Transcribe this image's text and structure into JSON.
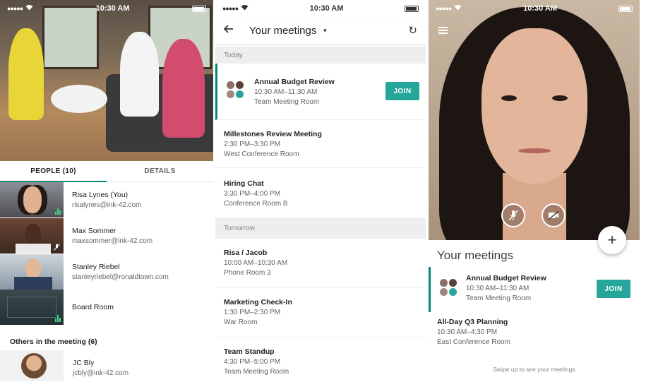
{
  "status_bar": {
    "time": "10:30 AM",
    "signal": "●●●●●"
  },
  "colors": {
    "accent": "#00897b",
    "join": "#26a69a",
    "talk_indicator": "#3ddc84"
  },
  "phone1": {
    "tabs": [
      {
        "label": "PEOPLE (10)"
      },
      {
        "label": "DETAILS"
      }
    ],
    "participants": [
      {
        "name": "Risa Lynes (You)",
        "email": "risalynes@ink-42.com"
      },
      {
        "name": "Max Sommer",
        "email": "maxsommer@ink-42.com"
      },
      {
        "name": "Stanley Riebel",
        "email": "stanleyriebel@ronaldtown.com"
      },
      {
        "name": "Board Room",
        "email": ""
      }
    ],
    "others_heading": "Others in the meeting  (6)",
    "others": [
      {
        "name": "JC Bly",
        "email": "jcbly@ink-42.com"
      }
    ]
  },
  "phone2": {
    "title": "Your meetings",
    "sections": [
      {
        "label": "Today",
        "meetings": [
          {
            "title": "Annual Budget Review",
            "time": "10:30 AM–11:30 AM",
            "room": "Team Meeting Room",
            "join": "JOIN"
          },
          {
            "title": "Millestones Review Meeting",
            "time": "2:30 PM–3:30 PM",
            "room": "West Conference Room"
          },
          {
            "title": "Hiring Chat",
            "time": "3:30 PM–4:00 PM",
            "room": "Conference Room B"
          }
        ]
      },
      {
        "label": "Tomorrow",
        "meetings": [
          {
            "title": "Risa / Jacob",
            "time": "10:00 AM–10:30 AM",
            "room": "Phone Room 3"
          },
          {
            "title": "Marketing Check-In",
            "time": "1:30 PM–2:30 PM",
            "room": "War Room"
          },
          {
            "title": "Team Standup",
            "time": "4:30 PM–5:00 PM",
            "room": "Team Meeting Room"
          }
        ]
      }
    ]
  },
  "phone3": {
    "title": "Your meetings",
    "fab": "+",
    "meetings": [
      {
        "title": "Annual Budget Review",
        "time": "10:30 AM–11:30 AM",
        "room": "Team Meeting Room",
        "join": "JOIN"
      },
      {
        "title": "All-Day Q3 Planning",
        "time": "10:30 AM–4:30 PM",
        "room": "East Conference Room"
      }
    ],
    "swipe_hint": "Swipe up to see your meetings"
  }
}
